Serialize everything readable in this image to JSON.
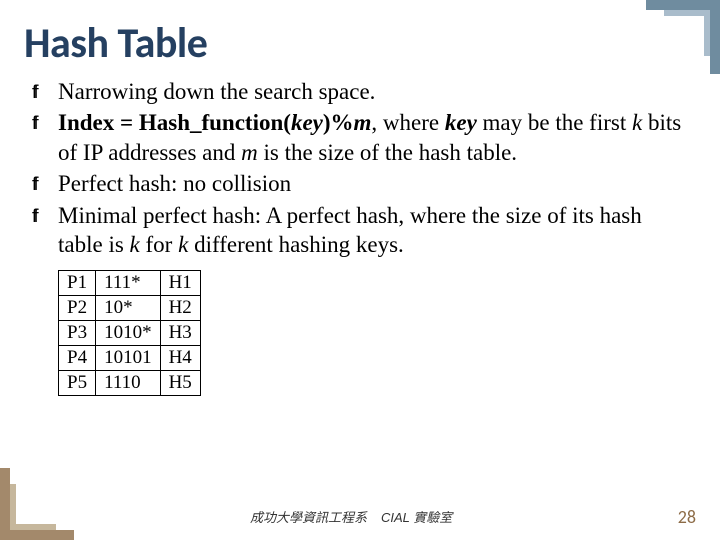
{
  "title": "Hash Table",
  "bullets": {
    "b0": "Narrowing down the search space.",
    "b1_prefix": "Index = Hash_function(",
    "b1_key": "key",
    "b1_mid": ")%",
    "b1_m": "m",
    "b1_where": ", where ",
    "b1_key2": "key",
    "b1_tail1": " may be the first ",
    "b1_k": "k",
    "b1_tail2": " bits of IP addresses and ",
    "b1_m2": "m",
    "b1_tail3": " is the size of the hash table.",
    "b2": "Perfect hash: no collision",
    "b3_head": "Minimal perfect hash: A perfect hash, where the size of its hash table is ",
    "b3_k1": "k",
    "b3_mid": " for ",
    "b3_k2": "k",
    "b3_tail": " different hashing keys."
  },
  "chart_data": {
    "type": "table",
    "columns": [
      "prefix_id",
      "pattern",
      "hash_id"
    ],
    "rows": [
      {
        "prefix_id": "P1",
        "pattern": "111*",
        "hash_id": "H1"
      },
      {
        "prefix_id": "P2",
        "pattern": "10*",
        "hash_id": "H2"
      },
      {
        "prefix_id": "P3",
        "pattern": "1010*",
        "hash_id": "H3"
      },
      {
        "prefix_id": "P4",
        "pattern": "10101",
        "hash_id": "H4"
      },
      {
        "prefix_id": "P5",
        "pattern": "1110",
        "hash_id": "H5"
      }
    ]
  },
  "footer": {
    "dept": "成功大學資訊工程系",
    "lab": "CIAL 實驗室"
  },
  "page_number": "28",
  "bullet_glyph": "ff"
}
